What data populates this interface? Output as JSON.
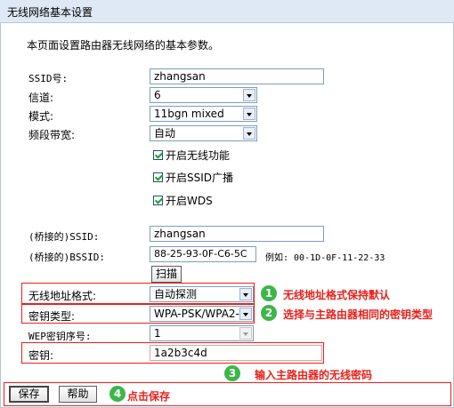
{
  "title": "无线网络基本设置",
  "description": "本页面设置路由器无线网络的基本参数。",
  "fields": {
    "ssid": {
      "label": "SSID号:",
      "value": "zhangsan"
    },
    "channel": {
      "label": "信道:",
      "value": "6"
    },
    "mode": {
      "label": "模式:",
      "value": "11bgn mixed"
    },
    "bandwidth": {
      "label": "频段带宽:",
      "value": "自动"
    },
    "bridge_ssid": {
      "label": "(桥接的)SSID:",
      "value": "zhangsan"
    },
    "bridge_bssid": {
      "label": "(桥接的)BSSID:",
      "value": "88-25-93-0F-C6-5C",
      "example": "例如: 00-1D-0F-11-22-33"
    },
    "address_format": {
      "label": "无线地址格式:",
      "value": "自动探测"
    },
    "key_type": {
      "label": "密钥类型:",
      "value": "WPA-PSK/WPA2-"
    },
    "wep_index": {
      "label": "WEP密钥序号:",
      "value": "1"
    },
    "key": {
      "label": "密钥:",
      "value": "1a2b3c4d"
    }
  },
  "checkboxes": {
    "enable_wireless": "开启无线功能",
    "enable_ssid_broadcast": "开启SSID广播",
    "enable_wds": "开启WDS"
  },
  "buttons": {
    "scan": "扫描",
    "save": "保存",
    "help": "帮助"
  },
  "annotations": {
    "n1": "1",
    "t1": "无线地址格式保持默认",
    "n2": "2",
    "t2": "选择与主路由器相同的密钥类型",
    "n3": "3",
    "t3": "输入主路由器的无线密码",
    "n4": "4",
    "t4": "点击保存"
  },
  "colors": {
    "annotation_red": "#e8201b",
    "badge_green": "#3cb64a",
    "titlebar": "#dfe9f5"
  }
}
